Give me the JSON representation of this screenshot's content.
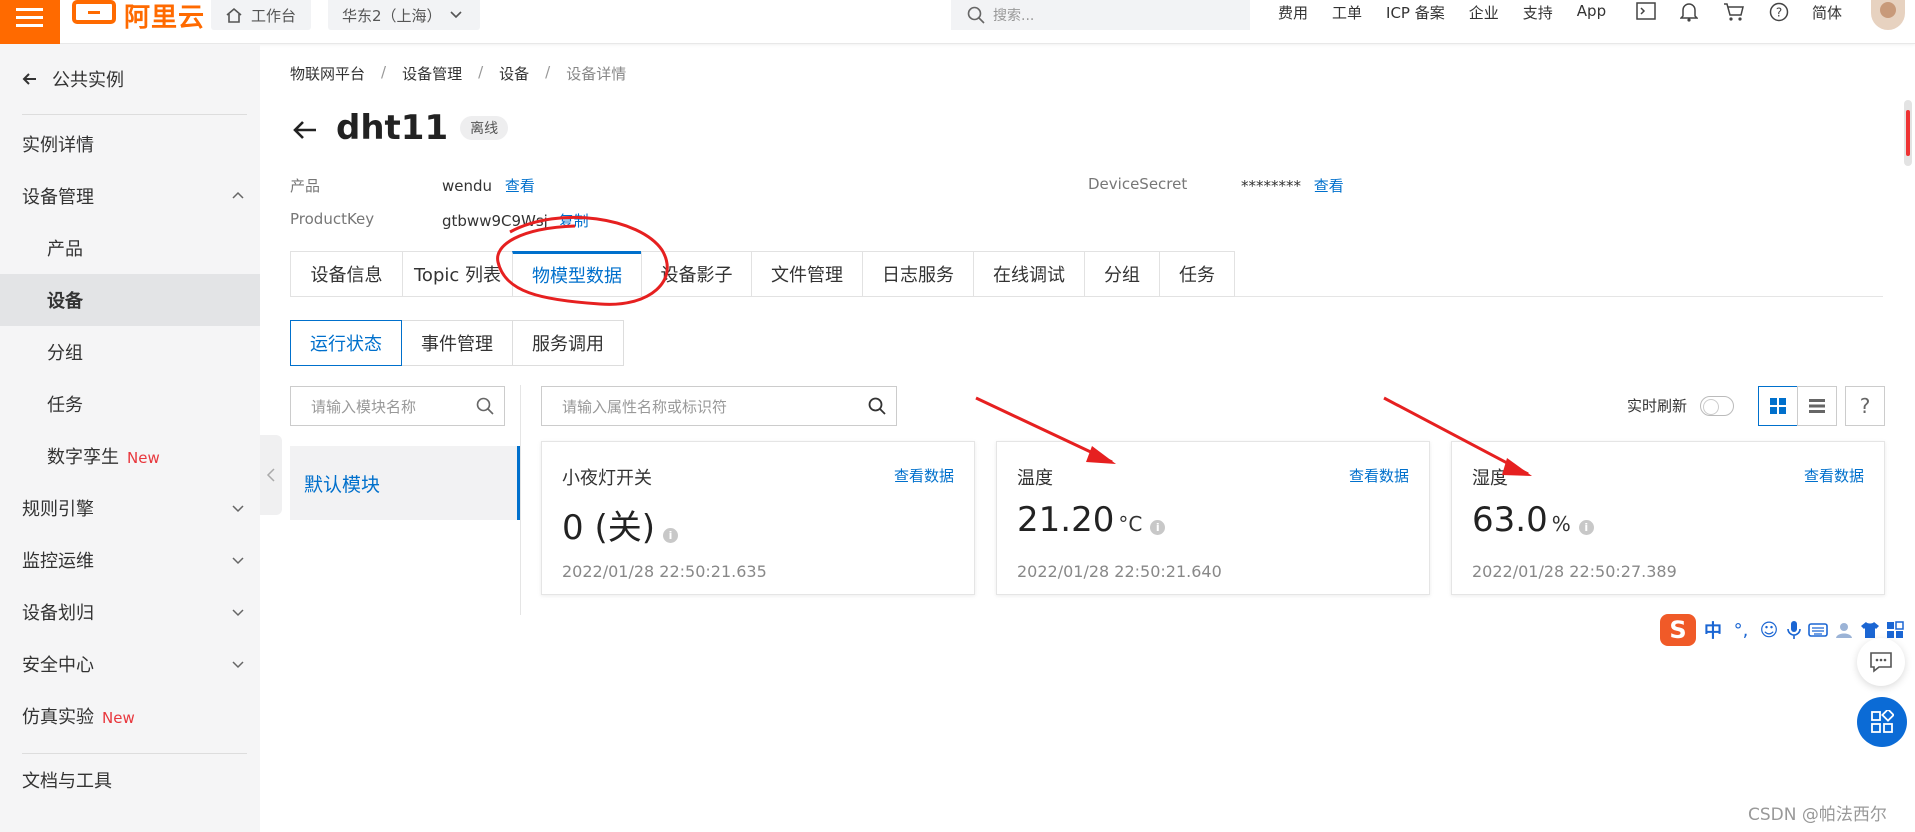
{
  "topbar": {
    "logo_text": "阿里云",
    "workbench_label": "工作台",
    "region_label": "华东2（上海）",
    "search_placeholder": "搜索...",
    "links": [
      "费用",
      "工单",
      "ICP 备案",
      "企业",
      "支持",
      "App"
    ],
    "lang_label": "简体"
  },
  "sidebar": {
    "back_label": "公共实例",
    "items": [
      {
        "label": "实例详情"
      },
      {
        "label": "设备管理"
      },
      {
        "label": "产品"
      },
      {
        "label": "设备"
      },
      {
        "label": "分组"
      },
      {
        "label": "任务"
      },
      {
        "label": "数字孪生",
        "tag": "New"
      },
      {
        "label": "规则引擎"
      },
      {
        "label": "监控运维"
      },
      {
        "label": "设备划归"
      },
      {
        "label": "安全中心"
      },
      {
        "label": "仿真实验",
        "tag": "New"
      },
      {
        "label": "文档与工具"
      }
    ]
  },
  "breadcrumb": [
    "物联网平台",
    "设备管理",
    "设备",
    "设备详情"
  ],
  "device": {
    "name": "dht11",
    "status": "离线",
    "product_label": "产品",
    "product_value": "wendu",
    "product_link": "查看",
    "productkey_label": "ProductKey",
    "productkey_value": "gtbww9C9Wsj",
    "productkey_link": "复制",
    "secret_label": "DeviceSecret",
    "secret_value": "********",
    "secret_link": "查看"
  },
  "tabs": [
    "设备信息",
    "Topic 列表",
    "物模型数据",
    "设备影子",
    "文件管理",
    "日志服务",
    "在线调试",
    "分组",
    "任务"
  ],
  "subtabs": [
    "运行状态",
    "事件管理",
    "服务调用"
  ],
  "module_search_placeholder": "请输入模块名称",
  "property_search_placeholder": "请输入属性名称或标识符",
  "module_item": "默认模块",
  "realtime_label": "实时刷新",
  "cards": [
    {
      "name": "小夜灯开关",
      "link": "查看数据",
      "value": "0 (关)",
      "unit": "",
      "time": "2022/01/28 22:50:21.635"
    },
    {
      "name": "温度",
      "link": "查看数据",
      "value": "21.20",
      "unit": "°C",
      "time": "2022/01/28 22:50:21.640"
    },
    {
      "name": "湿度",
      "link": "查看数据",
      "value": "63.0",
      "unit": "%",
      "time": "2022/01/28 22:50:27.389"
    }
  ],
  "ime_label": "中",
  "watermark": "CSDN @帕法西尔",
  "colors": {
    "brand": "#ff6a00",
    "accent": "#0070cc",
    "annotation": "#e62020"
  }
}
